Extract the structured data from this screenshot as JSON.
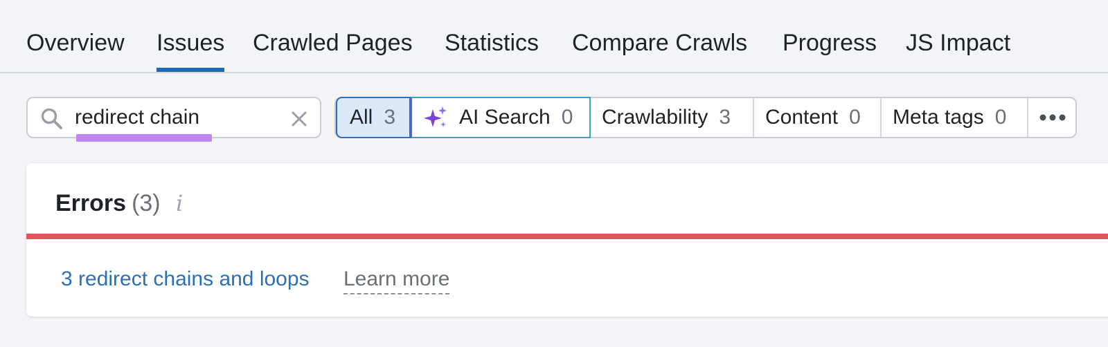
{
  "tabs": [
    {
      "label": "Overview"
    },
    {
      "label": "Issues"
    },
    {
      "label": "Crawled Pages"
    },
    {
      "label": "Statistics"
    },
    {
      "label": "Compare Crawls"
    },
    {
      "label": "Progress"
    },
    {
      "label": "JS Impact"
    }
  ],
  "active_tab": "Issues",
  "search": {
    "value": "redirect chain",
    "icon": "search-icon",
    "clear_icon": "close-icon"
  },
  "filters": [
    {
      "label": "All",
      "count": "3"
    },
    {
      "label": "AI Search",
      "count": "0",
      "icon": "sparkle-icon"
    },
    {
      "label": "Crawlability",
      "count": "3"
    },
    {
      "label": "Content",
      "count": "0"
    },
    {
      "label": "Meta tags",
      "count": "0"
    }
  ],
  "more_label": "•••",
  "errors": {
    "title": "Errors",
    "count": "(3)",
    "info_glyph": "i",
    "issue_link": "3 redirect chains and loops",
    "learn_more": "Learn more"
  },
  "colors": {
    "accent": "#1a6bb5",
    "error": "#e4555d",
    "highlight": "#bf86f2",
    "ai": "#7a45d6"
  }
}
